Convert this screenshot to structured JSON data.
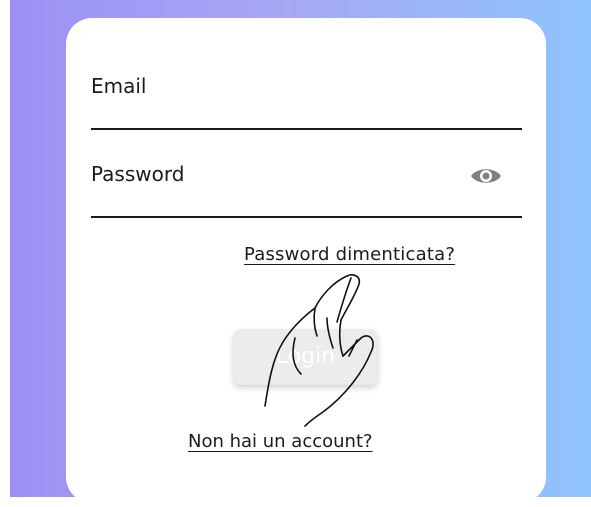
{
  "form": {
    "email_label": "Email",
    "password_label": "Password",
    "show_password_icon": "eye-icon",
    "forgot_password_link": "Password dimenticata?",
    "login_button": "Login",
    "signup_link": "Non hai un account?"
  },
  "overlay": {
    "pointer_icon": "hand-pointer-icon"
  },
  "colors": {
    "gradient_start": "#9b91f5",
    "gradient_end": "#8fc4fb",
    "card_background": "#ffffff",
    "button_background": "#ececec",
    "eye_icon": "#808080"
  }
}
